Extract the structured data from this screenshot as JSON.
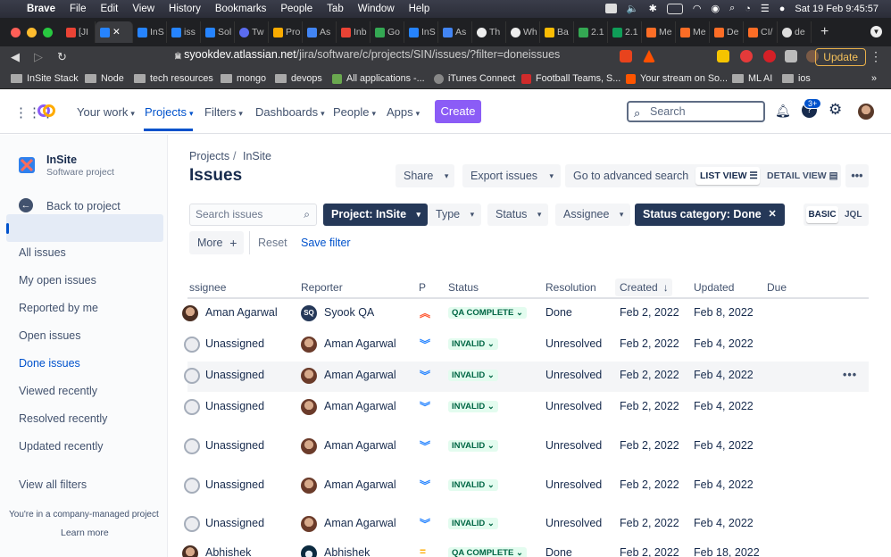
{
  "macbar": {
    "apple": "",
    "app": "Brave",
    "menu": [
      "File",
      "Edit",
      "View",
      "History",
      "Bookmarks",
      "People",
      "Tab",
      "Window",
      "Help"
    ],
    "clock": "Sat 19 Feb  9:45:57"
  },
  "tabs": [
    "[JI",
    "",
    "InS",
    "iss",
    "Sol",
    "Tw",
    "Pro",
    "As",
    "Inb",
    "Go",
    "InS",
    "As",
    "Th",
    "Wh",
    "Ba",
    "2.1",
    "2.1",
    "Me",
    "Me",
    "De",
    "CI/",
    "de"
  ],
  "address": {
    "host": "syookdev.atlassian.net",
    "path": "/jira/software/c/projects/SIN/issues/?filter=doneissues",
    "update": "Update",
    "badge": "1"
  },
  "bookmarks": [
    "InSite Stack",
    "Node",
    "tech resources",
    "mongo",
    "devops",
    "All applications -...",
    "iTunes Connect",
    "Football Teams, S...",
    "Your stream on So...",
    "ML AI",
    "ios"
  ],
  "topnav": {
    "your_work": "Your work",
    "projects": "Projects",
    "filters": "Filters",
    "dashboards": "Dashboards",
    "people": "People",
    "apps": "Apps",
    "create": "Create",
    "search_placeholder": "Search",
    "help_badge": "3+"
  },
  "sidebar": {
    "project_name": "InSite",
    "project_type": "Software project",
    "back": "Back to project",
    "items": [
      "All issues",
      "My open issues",
      "Reported by me",
      "Open issues",
      "Done issues",
      "Viewed recently",
      "Resolved recently",
      "Updated recently",
      "View all filters"
    ],
    "footer": "You're in a company-managed project",
    "learn_more": "Learn more"
  },
  "main": {
    "breadcrumb": [
      "Projects",
      "InSite"
    ],
    "title": "Issues",
    "share": "Share",
    "export": "Export issues",
    "advanced": "Go to advanced search",
    "list_view": "LIST VIEW",
    "detail_view": "DETAIL VIEW",
    "search_placeholder": "Search issues",
    "project_filter": "Project: InSite",
    "type": "Type",
    "status": "Status",
    "assignee": "Assignee",
    "status_category": "Status category: Done",
    "basic": "BASIC",
    "jql": "JQL",
    "more": "More",
    "reset": "Reset",
    "save_filter": "Save filter"
  },
  "table": {
    "headers": [
      "ssignee",
      "Reporter",
      "P",
      "Status",
      "Resolution",
      "Created",
      "Updated",
      "Due"
    ],
    "rows": [
      {
        "assignee": "Aman Agarwal",
        "reporter": "Syook QA",
        "reporter_initials": "SQ",
        "priority": "highest",
        "status": "QA COMPLETE",
        "resolution": "Done",
        "created": "Feb 2, 2022",
        "updated": "Feb 8, 2022"
      },
      {
        "assignee": "Unassigned",
        "reporter": "Aman Agarwal",
        "priority": "lowest",
        "status": "INVALID",
        "resolution": "Unresolved",
        "created": "Feb 2, 2022",
        "updated": "Feb 4, 2022"
      },
      {
        "assignee": "Unassigned",
        "reporter": "Aman Agarwal",
        "priority": "lowest",
        "status": "INVALID",
        "resolution": "Unresolved",
        "created": "Feb 2, 2022",
        "updated": "Feb 4, 2022"
      },
      {
        "assignee": "Unassigned",
        "reporter": "Aman Agarwal",
        "priority": "lowest",
        "status": "INVALID",
        "resolution": "Unresolved",
        "created": "Feb 2, 2022",
        "updated": "Feb 4, 2022"
      },
      {
        "assignee": "Unassigned",
        "reporter": "Aman Agarwal",
        "priority": "lowest",
        "status": "INVALID",
        "resolution": "Unresolved",
        "created": "Feb 2, 2022",
        "updated": "Feb 4, 2022"
      },
      {
        "assignee": "Unassigned",
        "reporter": "Aman Agarwal",
        "priority": "lowest",
        "status": "INVALID",
        "resolution": "Unresolved",
        "created": "Feb 2, 2022",
        "updated": "Feb 4, 2022"
      },
      {
        "assignee": "Unassigned",
        "reporter": "Aman Agarwal",
        "priority": "lowest",
        "status": "INVALID",
        "resolution": "Unresolved",
        "created": "Feb 2, 2022",
        "updated": "Feb 4, 2022"
      },
      {
        "assignee": "Abhishek",
        "reporter": "Abhishek",
        "priority": "medium",
        "status": "QA COMPLETE",
        "resolution": "Done",
        "created": "Feb 2, 2022",
        "updated": "Feb 18, 2022"
      }
    ]
  },
  "colors": {
    "primary": "#0052cc",
    "create": "#8b5cf6",
    "dark_filter": "#253858",
    "green_lozenge": "#e3fcef"
  }
}
